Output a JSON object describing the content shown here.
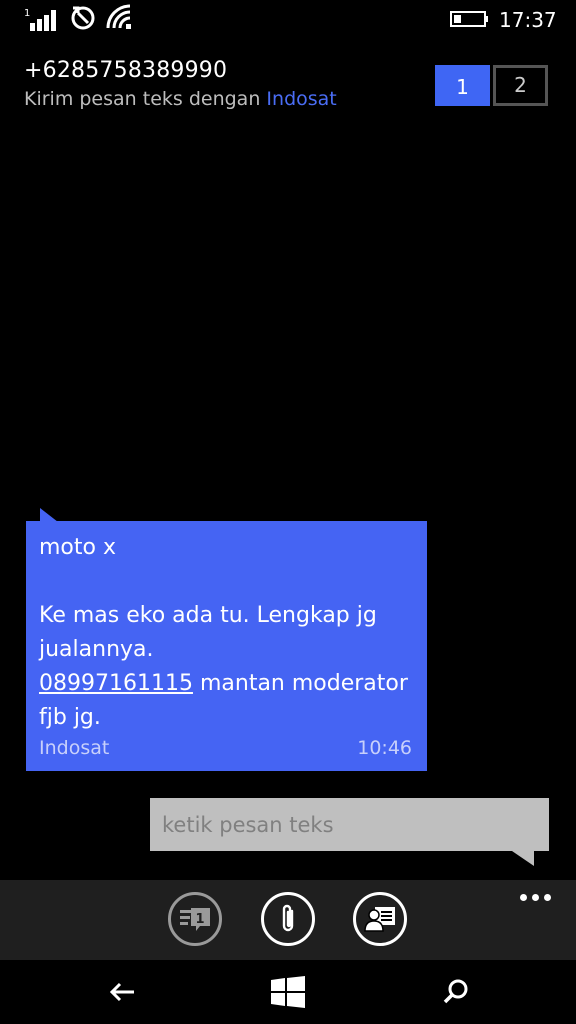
{
  "status_bar": {
    "sim_number": "1",
    "time": "17:37",
    "icons": [
      "signal-icon",
      "sim-status-icon",
      "wifi-icon",
      "battery-icon"
    ]
  },
  "header": {
    "phone_number": "+6285758389990",
    "send_prefix": "Kirim pesan teks dengan ",
    "carrier": "Indosat",
    "sim_tabs": [
      {
        "label": "1",
        "selected": true
      },
      {
        "label": "2",
        "selected": false
      }
    ]
  },
  "message": {
    "text_line1": "moto x",
    "text_line2": "Ke mas eko ada tu. Lengkap jg jualannya.",
    "link_number": "08997161115",
    "text_after_link": " mantan moderator fjb jg.",
    "sender": "Indosat",
    "time": "10:46"
  },
  "compose": {
    "placeholder": "ketik pesan teks"
  },
  "app_bar": {
    "unread_count": "1",
    "buttons": [
      "conversations-icon",
      "attach-icon",
      "contact-icon"
    ],
    "more_icon": "more-icon"
  },
  "nav_bar": {
    "buttons": [
      "back-icon",
      "windows-icon",
      "search-icon"
    ]
  },
  "colors": {
    "accent": "#4564f3",
    "background": "#000000",
    "compose_bg": "#bfbfbf",
    "appbar_bg": "#1f1f1f"
  }
}
